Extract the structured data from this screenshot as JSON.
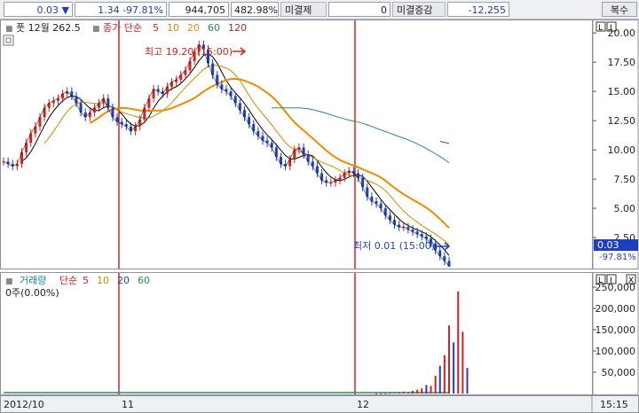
{
  "toolbar": {
    "price": "0.03",
    "change_arrow": "▼",
    "change": "1.34",
    "change_pct": "-97.81%",
    "volume": "944,705",
    "volume_pct": "482.98%",
    "label_unsettled": "미결제",
    "unsettled_value": "0",
    "label_unsettled_change": "미결증감",
    "unsettled_change_value": "-12,255",
    "restore_button": "복수"
  },
  "price_panel": {
    "title": "풋 12월 262.5",
    "legend_label": "종가 단순",
    "ma_periods": [
      "5",
      "10",
      "20",
      "60",
      "120"
    ],
    "annotation_high": "최고 19.20 (15:00)",
    "annotation_low": "최저 0.01 (15:00)",
    "last_price_tag": "0.03",
    "last_pct_tag": "-97.81%",
    "panel_buttons": [
      "L",
      "I"
    ]
  },
  "volume_panel": {
    "title": "거래량",
    "legend_label": "단순",
    "ma_periods": [
      "5",
      "10",
      "20",
      "60"
    ],
    "info": "0주(0.00%)",
    "panel_buttons": [
      "L",
      "I",
      "X"
    ]
  },
  "date_axis": {
    "labels": [
      "2012/10",
      "11",
      "12"
    ],
    "right_label": "15:15"
  },
  "colors": {
    "up": "#d42020",
    "down": "#1f3fbf",
    "ma5": "#000000",
    "ma10": "#c09000",
    "ma20": "#f08a00",
    "ma60": "#2e8b57",
    "ma120": "#a52a2a",
    "vline": "#d40000"
  },
  "chart_data": [
    {
      "type": "line",
      "title": "풋 12월 262.5",
      "ylim": [
        0,
        21
      ],
      "yticks": [
        2.5,
        5.0,
        7.5,
        10.0,
        12.5,
        15.0,
        17.5,
        20.0
      ],
      "ytick_labels": [
        "2.50",
        "5.00",
        "7.50",
        "10.00",
        "12.50",
        "15.00",
        "17.50",
        "20.00"
      ],
      "x": [
        0,
        1,
        2,
        3,
        4,
        5,
        6,
        7,
        8,
        9,
        10,
        11,
        12,
        13,
        14,
        15,
        16,
        17,
        18,
        19,
        20,
        21,
        22,
        23,
        24,
        25,
        26,
        27,
        28,
        29,
        30,
        31,
        32,
        33,
        34,
        35,
        36,
        37,
        38,
        39,
        40,
        41,
        42,
        43,
        44,
        45,
        46,
        47,
        48,
        49,
        50,
        51,
        52,
        53,
        54,
        55,
        56,
        57,
        58,
        59,
        60,
        61,
        62,
        63,
        64,
        65,
        66,
        67,
        68,
        69,
        70,
        71,
        72,
        73,
        74,
        75,
        76,
        77,
        78,
        79,
        80,
        81,
        82,
        83,
        84,
        85,
        86,
        87,
        88,
        89,
        90,
        91,
        92,
        93,
        94,
        95,
        96,
        97,
        98,
        99,
        100,
        101,
        102,
        103,
        104,
        105,
        106,
        107,
        108,
        109,
        110,
        111,
        112,
        113,
        114,
        115,
        116,
        117,
        118,
        119,
        120,
        121,
        122,
        123,
        124,
        125,
        126
      ],
      "series": [
        {
          "name": "종가",
          "values": [
            9.0,
            8.8,
            8.6,
            8.8,
            9.8,
            10.6,
            11.4,
            12.0,
            12.8,
            13.6,
            14.0,
            14.2,
            14.4,
            14.8,
            15.0,
            14.6,
            14.0,
            13.2,
            12.8,
            13.2,
            13.6,
            14.0,
            14.4,
            13.6,
            12.8,
            12.4,
            12.2,
            12.0,
            11.6,
            12.0,
            12.6,
            13.6,
            14.4,
            15.2,
            15.0,
            14.8,
            15.4,
            15.8,
            16.0,
            16.4,
            16.8,
            17.6,
            18.4,
            19.0,
            18.6,
            17.4,
            16.4,
            15.6,
            15.2,
            15.0,
            14.6,
            14.0,
            13.4,
            12.8,
            12.2,
            11.6,
            11.2,
            10.8,
            10.6,
            10.2,
            9.4,
            8.8,
            8.6,
            9.2,
            10.0,
            10.2,
            9.6,
            9.0,
            8.6,
            8.0,
            7.4,
            7.2,
            7.2,
            7.4,
            7.6,
            8.0,
            8.2,
            8.0,
            7.6,
            6.8,
            6.0,
            5.6,
            5.4,
            5.0,
            4.4,
            4.0,
            3.6,
            3.4,
            3.4,
            3.2,
            3.0,
            2.8,
            2.6,
            2.4,
            2.0,
            1.4,
            0.9,
            0.5,
            0.03
          ]
        }
      ]
    },
    {
      "type": "bar",
      "title": "거래량",
      "ylim": [
        0,
        250000
      ],
      "yticks": [
        50000,
        100000,
        150000,
        200000,
        250000
      ],
      "ytick_labels": [
        "50,000",
        "100,000",
        "150,000",
        "200,000",
        "250,000"
      ],
      "series": [
        {
          "name": "거래량",
          "values": [
            0,
            0,
            0,
            0,
            0,
            0,
            0,
            0,
            0,
            0,
            0,
            0,
            0,
            0,
            0,
            0,
            0,
            0,
            0,
            0,
            0,
            0,
            0,
            0,
            0,
            0,
            0,
            0,
            0,
            0,
            0,
            0,
            0,
            0,
            0,
            0,
            0,
            0,
            0,
            0,
            0,
            0,
            0,
            0,
            0,
            0,
            0,
            0,
            0,
            0,
            0,
            0,
            0,
            0,
            0,
            0,
            0,
            0,
            0,
            0,
            0,
            0,
            0,
            0,
            0,
            0,
            0,
            0,
            0,
            0,
            0,
            0,
            0,
            0,
            0,
            0,
            0,
            0,
            0,
            0,
            0,
            0,
            500,
            700,
            1200,
            1800,
            2500,
            3000,
            4500,
            3800,
            6000,
            9000,
            12000,
            20000,
            18000,
            42000,
            65000,
            90000,
            160000,
            120000,
            240000,
            145000,
            60000
          ]
        }
      ]
    }
  ]
}
